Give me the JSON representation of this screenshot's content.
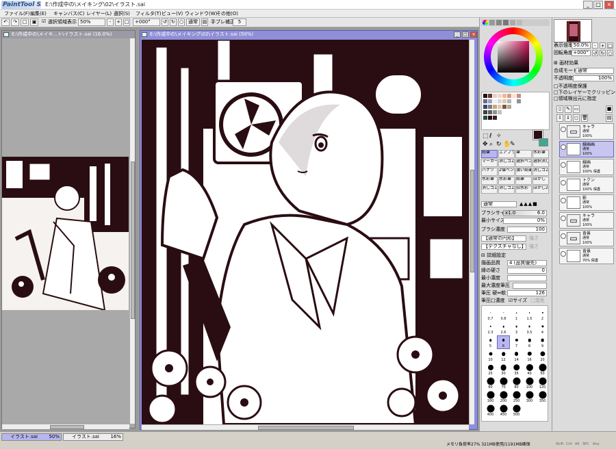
{
  "app": {
    "logo": "PaintTool SAI",
    "window_title": "E:\\作成中の\\メイキング\\02\\イラスト.sai"
  },
  "window_buttons": {
    "minimize": "_",
    "maximize": "□",
    "close": "×"
  },
  "menu": [
    "ファイル(F)",
    "編集(E)",
    "キャンバス(C)",
    "レイヤー(L)",
    "選択(S)",
    "フィルタ(T)",
    "ビュー(V)",
    "ウィンドウ(W)",
    "その他(O)"
  ],
  "toolbar": {
    "selection_label": "選択領域表示",
    "zoom": "50%",
    "rotation": "+000°",
    "mode": "通常",
    "stabilizer_label": "手ブレ補正",
    "stabilizer_value": "5"
  },
  "documents": {
    "left": {
      "title": "E:\\作成中の\\メイキ...ト\\イラスト.sai (16.0%)"
    },
    "main": {
      "title": "E:\\作成中の\\メイキング\\02\\イラスト.sai (50%)"
    }
  },
  "navigator": {
    "zoom_label": "表示倍率",
    "zoom_value": "50.0%",
    "rotate_label": "回転角度",
    "rotate_value": "+000°"
  },
  "layer_props": {
    "effect_label": "画材効果",
    "blend_label": "合成モード",
    "blend_value": "通常",
    "opacity_label": "不透明度",
    "opacity_value": "100%",
    "protect_alpha": "不透明度保護",
    "clip_lower": "下のレイヤーでクリッピング",
    "selection_source": "領域検出元に指定"
  },
  "layers": [
    {
      "name": "キャラ",
      "mode": "通常",
      "opacity": "100%",
      "type": "folder"
    },
    {
      "name": "線画画",
      "mode": "通常",
      "opacity": "100%",
      "type": "layer",
      "selected": true
    },
    {
      "name": "線画",
      "mode": "通常",
      "opacity": "100% 保護",
      "type": "layer"
    },
    {
      "name": "トクン",
      "mode": "通常",
      "opacity": "100% 保護",
      "type": "layer"
    },
    {
      "name": "影",
      "mode": "通常",
      "opacity": "100%",
      "type": "layer"
    },
    {
      "name": "キャラ",
      "mode": "通常",
      "opacity": "100%",
      "type": "folder"
    },
    {
      "name": "背景",
      "mode": "通常",
      "opacity": "100%",
      "type": "folder"
    },
    {
      "name": "背景",
      "mode": "通常",
      "opacity": "70% 保護",
      "type": "layer"
    }
  ],
  "brushes": [
    [
      "鉛筆",
      "エアブラシ",
      "筆",
      "水彩筆"
    ],
    [
      "マーカー",
      "消しゴム",
      "選択ペン",
      "選択消し"
    ],
    [
      "バケツ",
      "2値ペン",
      "濃い鉛筆",
      "消しゴム"
    ],
    [
      "水彩筆",
      "水彩筆",
      "鉛筆",
      "ほかし"
    ],
    [
      "消しゴム",
      "消しゴム",
      "旧水彩",
      "ほかし2"
    ]
  ],
  "brush_settings": {
    "mode": "通常",
    "size_label": "ブラシサイズ",
    "size_mult": "x1.0",
    "size_value": "6.0",
    "min_size_label": "最小サイズ",
    "min_size_value": "0%",
    "density_label": "ブラシ濃度",
    "density_value": "100",
    "shape_value": "【通常の円形】",
    "texture_value": "【テクスチャなし】",
    "shape_strength": "強さ",
    "texture_strength": "強さ",
    "detail_label": "詳細設定",
    "quality_label": "描画品質",
    "quality_value": "4 (品質優先)",
    "edge_label": "縁の硬さ",
    "edge_value": "0",
    "min_density_label": "最小濃度",
    "max_density_label": "最大濃度筆圧",
    "pressure_label": "筆圧 硬⇔軟",
    "pressure_value": "126",
    "pressure_opts_label": "筆圧:",
    "pressure_density": "濃度",
    "pressure_size": "サイズ",
    "pressure_blend": "混色"
  },
  "brush_sizes": [
    "0.7",
    "0.8",
    "1",
    "1.5",
    "2",
    "2.3",
    "2.6",
    "3",
    "3.5",
    "4",
    "5",
    "6",
    "7",
    "8",
    "9",
    "10",
    "12",
    "14",
    "16",
    "20",
    "25",
    "30",
    "35",
    "40",
    "50",
    "60",
    "70",
    "80",
    "100",
    "120",
    "160",
    "200",
    "250",
    "300",
    "350",
    "400",
    "450",
    "500"
  ],
  "selected_size": "6",
  "doc_tabs": [
    {
      "name": "イラスト.sai",
      "zoom": "50%",
      "active": true
    },
    {
      "name": "イラスト.sai",
      "zoom": "16%",
      "active": false
    }
  ],
  "status": {
    "memory": "メモリ負荷率27% 321MB使用/1191MB確保",
    "indicators": [
      "Shift",
      "Ctrl",
      "Alt",
      "SPC",
      "Any"
    ]
  },
  "colors": {
    "current_fg": "#2a0d12",
    "current_bg": "#3fa78c",
    "accent": "#8f8fd8"
  }
}
